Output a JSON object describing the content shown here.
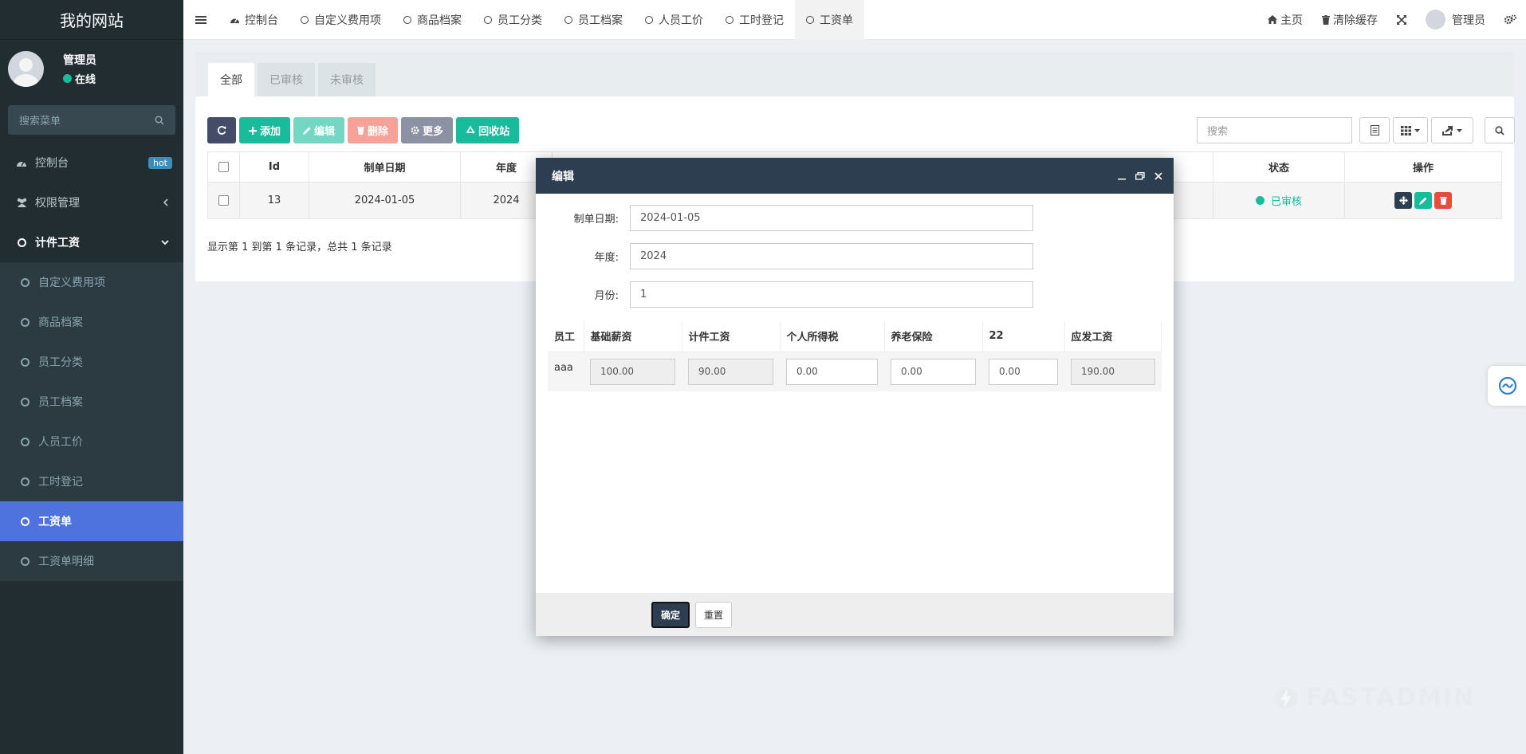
{
  "app": {
    "title": "我的网站"
  },
  "user": {
    "name": "管理员",
    "status": "在线"
  },
  "sidebar": {
    "search_placeholder": "搜索菜单",
    "items": [
      {
        "label": "控制台",
        "badge": "hot"
      },
      {
        "label": "权限管理"
      },
      {
        "label": "计件工资"
      }
    ],
    "sub_items": [
      "自定义费用项",
      "商品档案",
      "员工分类",
      "员工档案",
      "人员工价",
      "工时登记",
      "工资单",
      "工资单明细"
    ]
  },
  "topbar": {
    "tabs": [
      "控制台",
      "自定义费用项",
      "商品档案",
      "员工分类",
      "员工档案",
      "人员工价",
      "工时登记",
      "工资单"
    ],
    "home": "主页",
    "clear_cache": "清除缓存",
    "user": "管理员"
  },
  "panel": {
    "tabs": [
      "全部",
      "已审核",
      "未审核"
    ],
    "toolbar": {
      "add": "添加",
      "edit": "编辑",
      "delete": "删除",
      "more": "更多",
      "recycle": "回收站"
    },
    "search_placeholder": "搜索",
    "table": {
      "headers": {
        "id": "Id",
        "date": "制单日期",
        "year": "年度",
        "status": "状态",
        "ops": "操作"
      },
      "row": {
        "id": "13",
        "date": "2024-01-05",
        "year": "2024",
        "status": "已审核"
      }
    },
    "summary": "显示第 1 到第 1 条记录，总共 1 条记录"
  },
  "modal": {
    "title": "编辑",
    "fields": {
      "date_label": "制单日期:",
      "date_value": "2024-01-05",
      "year_label": "年度:",
      "year_value": "2024",
      "month_label": "月份:",
      "month_value": "1"
    },
    "salary_table": {
      "headers": [
        "员工",
        "基础薪资",
        "计件工资",
        "个人所得税",
        "养老保险",
        "22",
        "应发工资"
      ],
      "row": {
        "employee": "aaa",
        "base": "100.00",
        "piece": "90.00",
        "tax": "0.00",
        "pension": "0.00",
        "c22": "0.00",
        "gross": "190.00"
      }
    },
    "buttons": {
      "confirm": "确定",
      "reset": "重置"
    }
  },
  "watermark": "FASTADMIN",
  "colors": {
    "sidebar": "#222d32",
    "active": "#4e73df",
    "accent": "#18bc9c",
    "modal_header": "#2c3e50",
    "danger": "#e74c3c"
  }
}
